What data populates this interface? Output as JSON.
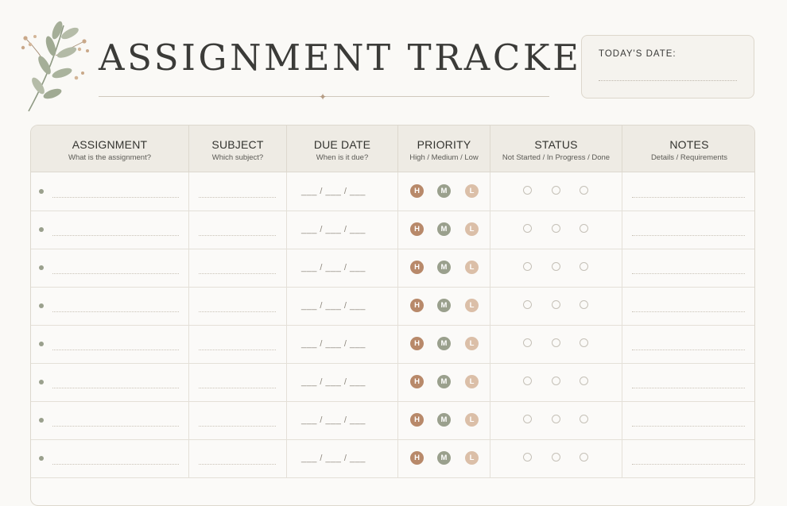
{
  "header": {
    "title": "ASSIGNMENT TRACKER",
    "todays_date_label": "TODAY'S DATE:"
  },
  "table": {
    "columns": [
      {
        "title": "ASSIGNMENT",
        "subtitle": "What is the assignment?"
      },
      {
        "title": "SUBJECT",
        "subtitle": "Which subject?"
      },
      {
        "title": "DUE DATE",
        "subtitle": "When is it due?"
      },
      {
        "title": "PRIORITY",
        "subtitle": "High / Medium / Low"
      },
      {
        "title": "STATUS",
        "subtitle": "Not Started / In Progress / Done"
      },
      {
        "title": "NOTES",
        "subtitle": "Details / Requirements"
      }
    ],
    "row_count": 8,
    "date_placeholder": "___ / ___ / ___",
    "priority_options": [
      {
        "letter": "H",
        "color": "#b8896a"
      },
      {
        "letter": "M",
        "color": "#9aa08d"
      },
      {
        "letter": "L",
        "color": "#dbbfa8"
      }
    ],
    "status_option_count": 3
  },
  "colors": {
    "background": "#faf9f6",
    "header_fill": "#eeebe4",
    "border": "#ddd8ce",
    "accent": "#b59c84"
  },
  "icons": {
    "decoration": "leaf-sprig-icon",
    "separator": "diamond-sparkle-icon"
  }
}
